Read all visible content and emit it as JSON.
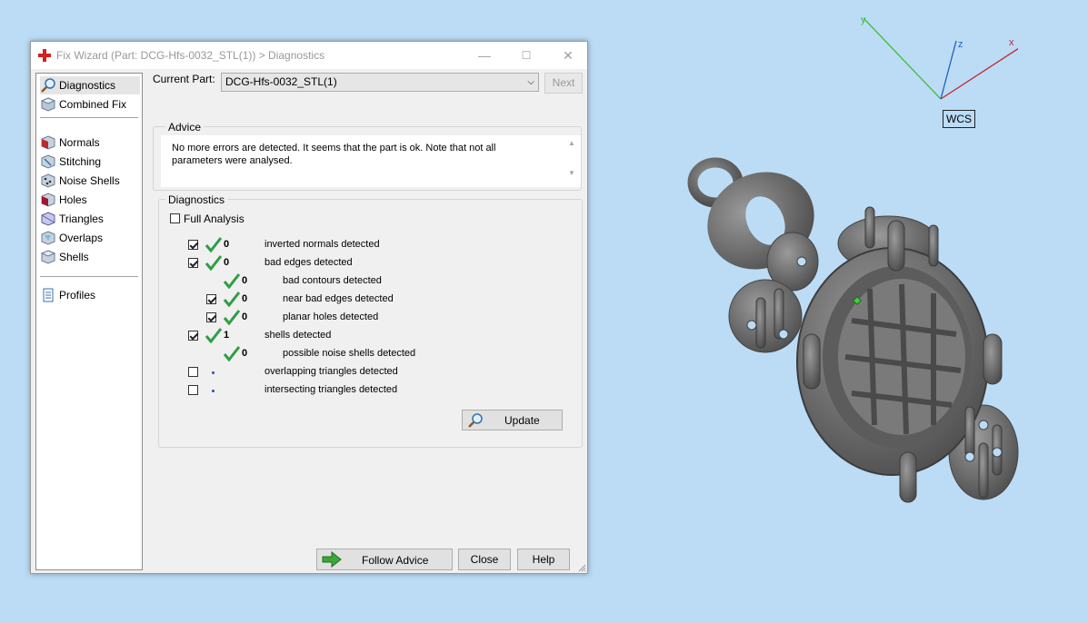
{
  "window": {
    "title": "Fix Wizard (Part: DCG-Hfs-0032_STL(1)) > Diagnostics",
    "controls": [
      "—",
      "☐",
      "✕"
    ]
  },
  "sidebar": {
    "items": [
      {
        "label": "Diagnostics",
        "icon": "magnifier-icon"
      },
      {
        "label": "Combined Fix",
        "icon": "cube-icon"
      },
      {
        "label": "Normals",
        "icon": "normals-icon"
      },
      {
        "label": "Stitching",
        "icon": "stitching-icon"
      },
      {
        "label": "Noise Shells",
        "icon": "noise-shells-icon"
      },
      {
        "label": "Holes",
        "icon": "holes-icon"
      },
      {
        "label": "Triangles",
        "icon": "triangles-icon"
      },
      {
        "label": "Overlaps",
        "icon": "overlaps-icon"
      },
      {
        "label": "Shells",
        "icon": "shells-icon"
      },
      {
        "label": "Profiles",
        "icon": "document-icon"
      }
    ]
  },
  "header": {
    "current_part_label": "Current Part:",
    "current_part_value": "DCG-Hfs-0032_STL(1)",
    "next_label": "Next"
  },
  "advice": {
    "title": "Advice",
    "text": "No more errors are detected. It seems that the part is ok. Note that not all parameters were analysed."
  },
  "diagnostics": {
    "title": "Diagnostics",
    "full_analysis_label": "Full Analysis",
    "rows": [
      {
        "checked": true,
        "status": "ok",
        "count": "0",
        "text": "inverted normals detected"
      },
      {
        "checked": true,
        "status": "ok",
        "count": "0",
        "text": "bad edges detected"
      },
      {
        "checked": null,
        "status": "ok",
        "count": "0",
        "text": "bad contours detected"
      },
      {
        "checked": true,
        "status": "ok",
        "count": "0",
        "text": "near bad edges detected"
      },
      {
        "checked": true,
        "status": "ok",
        "count": "0",
        "text": "planar holes detected"
      },
      {
        "checked": true,
        "status": "ok",
        "count": "1",
        "text": "shells detected"
      },
      {
        "checked": null,
        "status": "ok",
        "count": "0",
        "text": "possible noise shells detected"
      },
      {
        "checked": false,
        "status": "none",
        "count": "",
        "text": "overlapping triangles detected"
      },
      {
        "checked": false,
        "status": "none",
        "count": "",
        "text": "intersecting triangles detected"
      }
    ],
    "update_label": "Update"
  },
  "footer": {
    "follow_advice_label": "Follow Advice",
    "close_label": "Close",
    "help_label": "Help"
  },
  "viewport": {
    "axis_labels": {
      "x": "x",
      "y": "y",
      "z": "z"
    },
    "wcs_label": "WCS",
    "colors": {
      "x": "#c0282d",
      "y": "#3bbf3b",
      "z": "#1f5fbf",
      "background": "#bcdcf6",
      "model": "#6e6e6e"
    }
  }
}
